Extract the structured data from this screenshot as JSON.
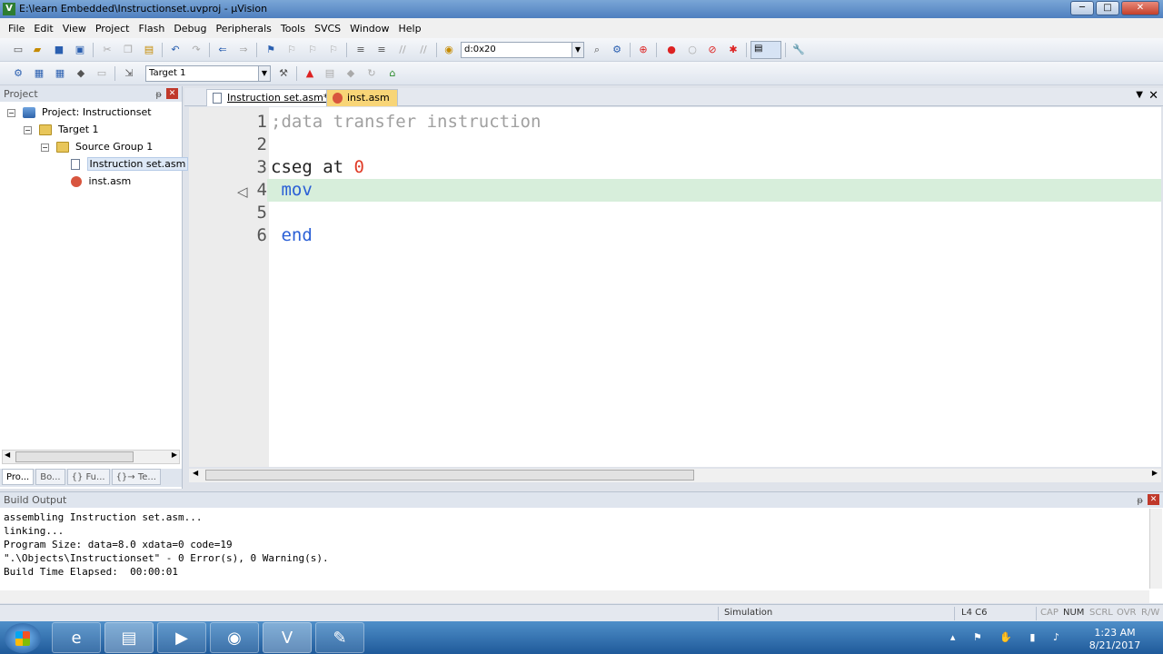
{
  "window": {
    "title": "E:\\learn Embedded\\Instructionset.uvproj - µVision",
    "buttons": [
      "─",
      "□",
      "✕"
    ]
  },
  "menu": [
    "File",
    "Edit",
    "View",
    "Project",
    "Flash",
    "Debug",
    "Peripherals",
    "Tools",
    "SVCS",
    "Window",
    "Help"
  ],
  "toolbar": {
    "address_combo": "d:0x20",
    "target_combo": "Target 1"
  },
  "project_panel": {
    "title": "Project",
    "tree": [
      {
        "label": "Project: Instructionset",
        "icon": "project-icon",
        "level": 0
      },
      {
        "label": "Target 1",
        "icon": "target-icon",
        "level": 1
      },
      {
        "label": "Source Group 1",
        "icon": "folder-icon",
        "level": 2
      },
      {
        "label": "Instruction set.asm",
        "icon": "file-icon",
        "level": 3
      },
      {
        "label": "inst.asm",
        "icon": "asm-file-icon",
        "level": 3
      }
    ],
    "tabs": [
      "Pro...",
      "Bo...",
      "{} Fu...",
      "{}→ Te..."
    ]
  },
  "editor": {
    "tabs": [
      "Instruction set.asm*",
      "inst.asm"
    ],
    "lines": [
      {
        "num": "1",
        "parts": [
          {
            "t": ";data transfer instruction",
            "c": "comment"
          }
        ]
      },
      {
        "num": "2",
        "parts": []
      },
      {
        "num": "3",
        "parts": [
          {
            "t": "cseg at ",
            "c": "plain"
          },
          {
            "t": "0",
            "c": "num"
          }
        ]
      },
      {
        "num": "4",
        "parts": [
          {
            "t": " mov",
            "c": "kw"
          }
        ],
        "current": true
      },
      {
        "num": "5",
        "parts": []
      },
      {
        "num": "6",
        "parts": [
          {
            "t": " end",
            "c": "kw"
          }
        ]
      }
    ]
  },
  "build_output": {
    "title": "Build Output",
    "lines": [
      "assembling Instruction set.asm...",
      "linking...",
      "Program Size: data=8.0 xdata=0 code=19",
      "\".\\Objects\\Instructionset\" - 0 Error(s), 0 Warning(s).",
      "Build Time Elapsed:  00:00:01"
    ]
  },
  "status": {
    "mode": "Simulation",
    "position": "L4 C6",
    "cap": "CAP",
    "num": "NUM",
    "scrl": "SCRL",
    "ovr": "OVR",
    "rw": "R/W"
  },
  "taskbar": {
    "apps": [
      "ie-icon",
      "explorer-icon",
      "media-player-icon",
      "obs-icon",
      "keil-icon",
      "flash-tool-icon"
    ],
    "time": "1:23 AM",
    "date": "8/21/2017"
  }
}
